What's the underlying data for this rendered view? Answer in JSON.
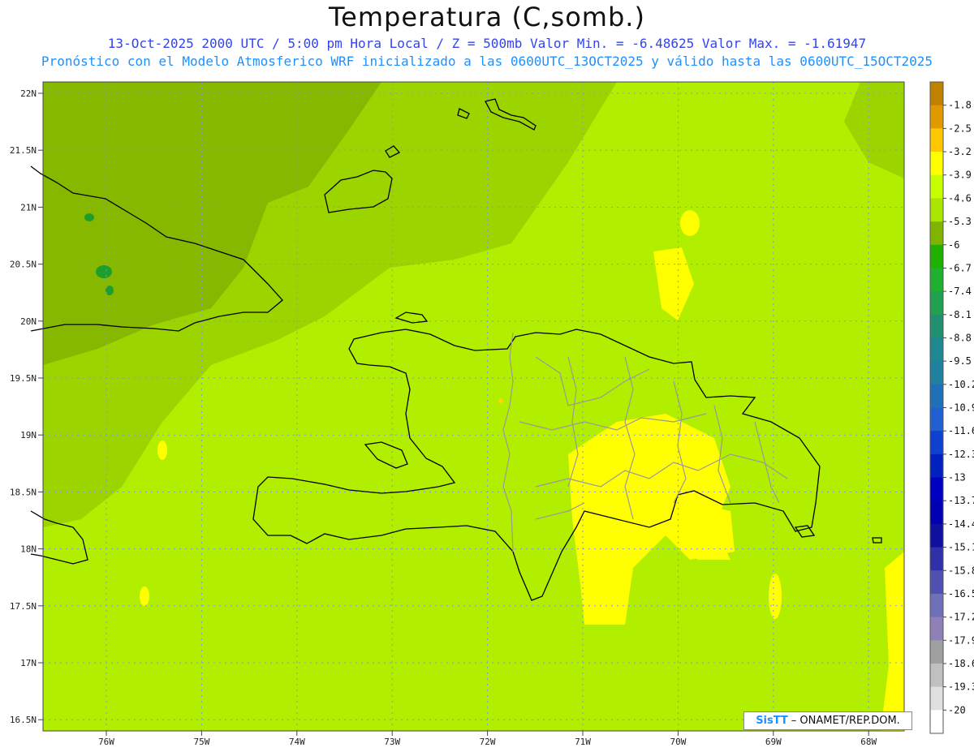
{
  "header": {
    "title": "Temperatura (C,somb.)",
    "line1": "13-Oct-2025  2000 UTC / 5:00 pm Hora Local / Z = 500mb  Valor Min. = -6.48625  Valor Max. = -1.61947",
    "line2": "Pronóstico con el Modelo Atmosferico WRF inicializado a las 0600UTC_13OCT2025 y válido hasta las  0600UTC_15OCT2025"
  },
  "axes": {
    "lat_labels": [
      "22N",
      "21.5N",
      "21N",
      "20.5N",
      "20N",
      "19.5N",
      "19N",
      "18.5N",
      "18N",
      "17.5N",
      "17N",
      "16.5N"
    ],
    "lon_labels": [
      "76W",
      "75W",
      "74W",
      "73W",
      "72W",
      "71W",
      "70W",
      "69W",
      "68W"
    ]
  },
  "colorbar": {
    "levels": [
      "-1.8",
      "-2.5",
      "-3.2",
      "-3.9",
      "-4.6",
      "-5.3",
      "-6",
      "-6.7",
      "-7.4",
      "-8.1",
      "-8.8",
      "-9.5",
      "-10.2",
      "-10.9",
      "-11.6",
      "-12.3",
      "-13",
      "-13.7",
      "-14.4",
      "-15.1",
      "-15.8",
      "-16.5",
      "-17.2",
      "-17.9",
      "-18.6",
      "-19.3",
      "-20"
    ],
    "colors": [
      "#c08000",
      "#e09a00",
      "#ffc800",
      "#ffff00",
      "#c8ff00",
      "#aae600",
      "#80b400",
      "#20b000",
      "#20b030",
      "#20a050",
      "#209070",
      "#208890",
      "#2080a0",
      "#2070b8",
      "#2060d0",
      "#1040d0",
      "#0020c0",
      "#0000c0",
      "#0000b0",
      "#1010a0",
      "#3030a8",
      "#5050b0",
      "#7070b8",
      "#9080b8",
      "#a0a0a0",
      "#c0c0c0",
      "#e0e0e0",
      "#ffffff"
    ]
  },
  "colors": {
    "base_field": "#b2ee00",
    "dark_field": "#9cd400",
    "darker_field": "#86b800",
    "warm_field": "#ffff00",
    "hot_field": "#ffd800",
    "cold_field": "#1e9e2a",
    "coast": "#000000",
    "province": "#999999",
    "grid": "#7f96e8"
  },
  "credit": {
    "logo": "SisTT",
    "text": "– ONAMET/REP.DOM."
  }
}
